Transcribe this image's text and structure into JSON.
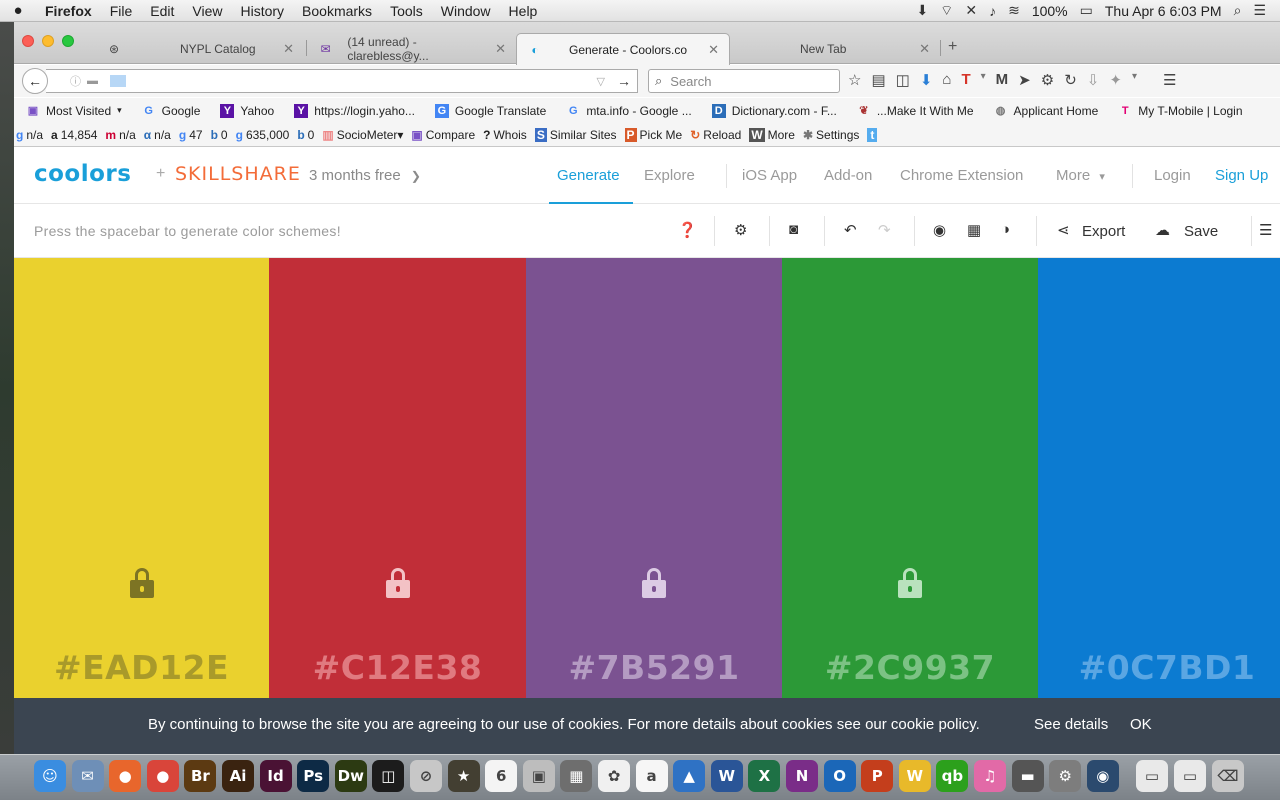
{
  "menubar": {
    "app": "Firefox",
    "items": [
      "File",
      "Edit",
      "View",
      "History",
      "Bookmarks",
      "Tools",
      "Window",
      "Help"
    ],
    "battery": "100%",
    "clock": "Thu Apr 6  6:03 PM"
  },
  "tabs": [
    {
      "title": "NYPL Catalog",
      "icon": "nypl-icon"
    },
    {
      "title": "(14 unread) - clarebless@y...",
      "icon": "yahoo-mail-icon"
    },
    {
      "title": "Generate - Coolors.co",
      "icon": "coolors-icon"
    },
    {
      "title": "New Tab",
      "icon": ""
    }
  ],
  "navbar": {
    "url": "",
    "search_placeholder": "Search"
  },
  "bookmarks": [
    {
      "label": "Most Visited",
      "icon": "G"
    },
    {
      "label": "Google",
      "icon": "G"
    },
    {
      "label": "Yahoo",
      "icon": "Y"
    },
    {
      "label": "https://login.yaho...",
      "icon": "Y"
    },
    {
      "label": "Google Translate",
      "icon": "G"
    },
    {
      "label": "mta.info - Google ...",
      "icon": "G"
    },
    {
      "label": "Dictionary.com - F...",
      "icon": "D"
    },
    {
      "label": "...Make It With Me",
      "icon": "M"
    },
    {
      "label": "Applicant Home",
      "icon": "A"
    },
    {
      "label": "My T-Mobile | Login",
      "icon": "T"
    }
  ],
  "seobar": [
    {
      "icon": "g",
      "label": "n/a"
    },
    {
      "icon": "a",
      "label": "14,854"
    },
    {
      "icon": "m",
      "label": "n/a"
    },
    {
      "icon": "α",
      "label": "n/a"
    },
    {
      "icon": "g",
      "label": "47"
    },
    {
      "icon": "b",
      "label": "0"
    },
    {
      "icon": "g",
      "label": "635,000"
    },
    {
      "icon": "b",
      "label": "0"
    },
    {
      "icon": "▥",
      "label": "SocioMeter▾"
    },
    {
      "icon": "▣",
      "label": "Compare"
    },
    {
      "icon": "?",
      "label": "Whois"
    },
    {
      "icon": "S",
      "label": "Similar Sites"
    },
    {
      "icon": "P",
      "label": "Pick Me"
    },
    {
      "icon": "↻",
      "label": "Reload"
    },
    {
      "icon": "W",
      "label": "More"
    },
    {
      "icon": "✱",
      "label": "Settings"
    }
  ],
  "site": {
    "logo": "coolors",
    "plus": "+",
    "partner": "SKILLSHARE",
    "promo": "3 months free",
    "nav": {
      "generate": "Generate",
      "explore": "Explore",
      "ios": "iOS App",
      "addon": "Add-on",
      "chrome": "Chrome Extension",
      "more": "More",
      "login": "Login",
      "signup": "Sign Up"
    },
    "hint": "Press the spacebar to generate color schemes!",
    "export_label": "Export",
    "save_label": "Save"
  },
  "palette": [
    {
      "hex": "#EAD12E",
      "color": "#EAD12E",
      "text": "#a99a2a",
      "lock": "#7d7424"
    },
    {
      "hex": "#C12E38",
      "color": "#C12E38",
      "text": "#e07a80",
      "lock": "#f3c2c5"
    },
    {
      "hex": "#7B5291",
      "color": "#7B5291",
      "text": "#b49bc2",
      "lock": "#dccbe4"
    },
    {
      "hex": "#2C9937",
      "color": "#2C9937",
      "text": "#7cc284",
      "lock": "#b9e2bd"
    },
    {
      "hex": "#0C7BD1",
      "color": "#0C7BD1",
      "text": "#5aa6e3",
      "lock": "#a5cdf0"
    }
  ],
  "cookie": {
    "text": "By continuing to browse the site you are agreeing to our use of cookies. For more details about cookies see our cookie policy.",
    "details": "See details",
    "ok": "OK"
  },
  "dock": [
    {
      "name": "finder",
      "label": "☺",
      "color": "#3a8de0"
    },
    {
      "name": "preview",
      "label": "✉",
      "color": "#6e8fb7"
    },
    {
      "name": "firefox",
      "label": "●",
      "color": "#e8662c"
    },
    {
      "name": "chrome",
      "label": "●",
      "color": "#d9453a"
    },
    {
      "name": "bridge",
      "label": "Br",
      "color": "#5c3a12"
    },
    {
      "name": "illustrator",
      "label": "Ai",
      "color": "#3a2310"
    },
    {
      "name": "indesign",
      "label": "Id",
      "color": "#4a1234"
    },
    {
      "name": "photoshop",
      "label": "Ps",
      "color": "#0d2a45"
    },
    {
      "name": "dreamweaver",
      "label": "Dw",
      "color": "#2c3a12"
    },
    {
      "name": "app-9",
      "label": "◫",
      "color": "#1c1c1c"
    },
    {
      "name": "app-10",
      "label": "⊘",
      "color": "#c7c7c7"
    },
    {
      "name": "imovie",
      "label": "★",
      "color": "#433f32"
    },
    {
      "name": "calendar",
      "label": "6",
      "color": "#f4f4f4"
    },
    {
      "name": "dvd-player",
      "label": "▣",
      "color": "#bdbdbd"
    },
    {
      "name": "calculator",
      "label": "▦",
      "color": "#6e6e6e"
    },
    {
      "name": "photos",
      "label": "✿",
      "color": "#f0f0f0"
    },
    {
      "name": "amazon",
      "label": "a",
      "color": "#f6f6f6"
    },
    {
      "name": "app-18",
      "label": "▲",
      "color": "#2f72c4"
    },
    {
      "name": "word",
      "label": "W",
      "color": "#2a5597"
    },
    {
      "name": "excel",
      "label": "X",
      "color": "#1e7145"
    },
    {
      "name": "onenote",
      "label": "N",
      "color": "#7a2d88"
    },
    {
      "name": "outlook",
      "label": "O",
      "color": "#1b67b8"
    },
    {
      "name": "powerpoint",
      "label": "P",
      "color": "#c43e1c"
    },
    {
      "name": "app-24",
      "label": "W",
      "color": "#e8b92a"
    },
    {
      "name": "quickbooks",
      "label": "qb",
      "color": "#2ca01c"
    },
    {
      "name": "itunes",
      "label": "♫",
      "color": "#e26aa7"
    },
    {
      "name": "app-27",
      "label": "▬",
      "color": "#555555"
    },
    {
      "name": "system-preferences",
      "label": "⚙",
      "color": "#7d7d7d"
    },
    {
      "name": "app-29",
      "label": "◉",
      "color": "#2b4a6e"
    },
    {
      "name": "app-30",
      "label": "▭",
      "color": "#e9e9e9"
    },
    {
      "name": "app-31",
      "label": "▭",
      "color": "#e9e9e9"
    },
    {
      "name": "trash",
      "label": "⌫",
      "color": "#c8c8c8"
    }
  ]
}
